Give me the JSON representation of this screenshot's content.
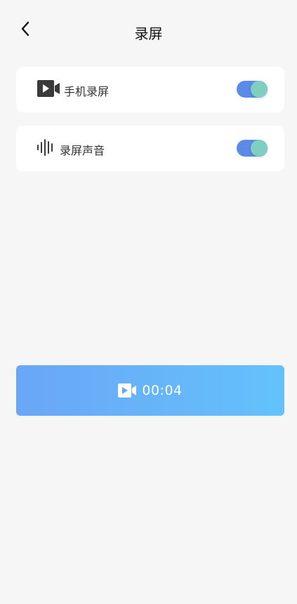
{
  "header": {
    "title": "录屏",
    "back_icon": "chevron-left-icon"
  },
  "settings": [
    {
      "label": "手机录屏",
      "icon": "video-camera-icon",
      "enabled": true
    },
    {
      "label": "录屏声音",
      "icon": "sound-wave-icon",
      "enabled": true
    }
  ],
  "record_button": {
    "time": "00:04",
    "icon": "video-camera-icon"
  },
  "colors": {
    "toggle_track": "#5b8be7",
    "toggle_knob": "#7fcfc1",
    "button_gradient_start": "#6aa6f6",
    "button_gradient_end": "#63c2fb",
    "background": "#f6f6f6"
  }
}
